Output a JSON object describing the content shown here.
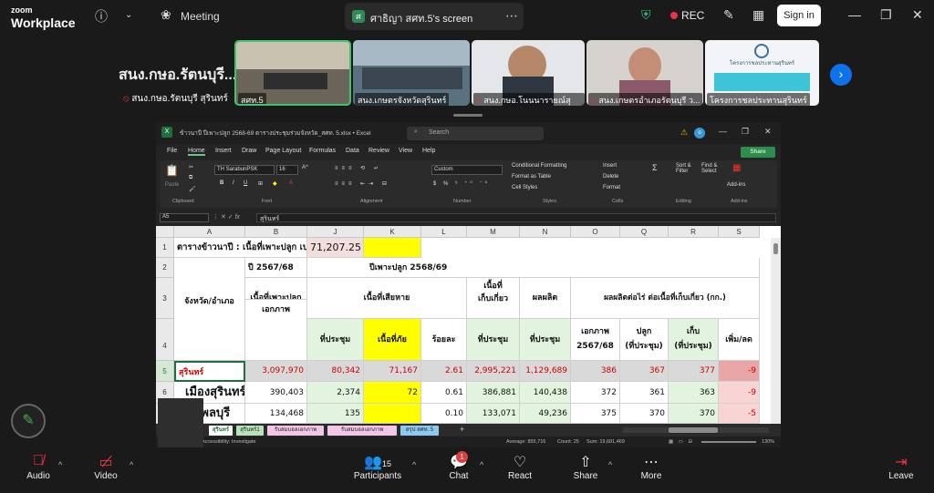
{
  "topbar": {
    "logo_line1": "zoom",
    "logo_line2": "Workplace",
    "meeting_label": "Meeting",
    "screen_label": "ศาธิญา สศท.5's screen",
    "avatar_letter": "ศ",
    "rec_label": "REC",
    "signin_label": "Sign in"
  },
  "participants_strip": {
    "title": "สนง.กษอ.รัตนบุรี...",
    "self_name": "สนง.กษอ.รัตนบุรี สุรินทร์",
    "tiles": [
      {
        "name": "สศท.5"
      },
      {
        "name": "สนง.เกษตรจังหวัดสุรินทร์"
      },
      {
        "name": "สนง.กษอ.โนนนารายณ์สุริน..."
      },
      {
        "name": "สนง.เกษตรอำเภอรัตนบุรี ว..."
      },
      {
        "name": "โครงการชลประทานสุรินทร์"
      }
    ],
    "tile5_banner": "โครงการชลประทานสุรินทร์"
  },
  "excel": {
    "filename": "ข้าวนาปี ปีเพาะปลูก 2568-69 ตารางประชุมร่วมจังหวัด_สศท. 5.xlsx  •  Excel",
    "search_placeholder": "Search",
    "share_label": "Share",
    "menu": [
      "File",
      "Home",
      "Insert",
      "Draw",
      "Page Layout",
      "Formulas",
      "Data",
      "Review",
      "View",
      "Help"
    ],
    "ribbon": {
      "groups": [
        "Clipboard",
        "Font",
        "Alignment",
        "Number",
        "Styles",
        "Cells",
        "Editing",
        "Add-ins"
      ],
      "paste": "Paste",
      "font_name": "TH SarabunPSK",
      "font_size": "16",
      "number_format": "Custom",
      "conditional": "Conditional Formatting",
      "format_table": "Format as Table",
      "cell_styles": "Cell Styles",
      "insert": "Insert",
      "delete": "Delete",
      "format": "Format",
      "sort": "Sort & Filter",
      "find": "Find & Select",
      "addins": "Add-ins"
    },
    "namebox": "A5",
    "formula": "สุรินทร์",
    "columns": [
      "A",
      "B",
      "J",
      "K",
      "L",
      "M",
      "N",
      "O",
      "Q",
      "R",
      "S"
    ],
    "rows": [
      "1",
      "2",
      "3",
      "4",
      "5",
      "6",
      "7"
    ],
    "cells": {
      "r1_label": "ตารางข้าวนาปี :  เนื้อที่เพาะปลูก เป",
      "r1_value": "71,207.25",
      "r2_b": "ปี 2567/68",
      "r2_k": "ปีเพาะปลูก 2568/69",
      "h_a": "จังหวัด/อำเภอ",
      "h_b1": "เนื้อที่เพาะปลูก",
      "h_b2": "เอกภาพ",
      "h_damage": "เนื้อที่เสียหาย",
      "h_m": "เนื้อที่\nเก็บเกี่ยว",
      "h_n": "ผลผลิต",
      "h_yield": "ผลผลิตต่อไร่ ต่อเนื้อที่เก็บเกี่ยว (กก.)",
      "h4_j": "ที่ประชุม",
      "h4_k": "เนื้อที่ภัย",
      "h4_l": "ร้อยละ",
      "h4_m": "ที่ประชุม",
      "h4_n": "ที่ประชุม",
      "h4_o": "เอกภาพ\n2567/68",
      "h4_q": "ปลูก\n(ที่ประชุม)",
      "h4_r": "เก็บ\n(ที่ประชุม)",
      "h4_s": "เพิ่ม/ลด"
    },
    "data_rows": [
      {
        "a": "สุรินทร์",
        "b": "3,097,970",
        "j": "80,342",
        "k": "71,167",
        "l": "2.61",
        "m": "2,995,221",
        "n": "1,129,689",
        "o": "386",
        "q": "367",
        "r": "377",
        "s": "-9"
      },
      {
        "a": "เมืองสุรินทร์",
        "b": "390,403",
        "j": "2,374",
        "k": "72",
        "l": "0.61",
        "m": "386,881",
        "n": "140,438",
        "o": "372",
        "q": "361",
        "r": "363",
        "s": "-9"
      },
      {
        "a": "ชุมพลบุรี",
        "b": "134,468",
        "j": "135",
        "k": "",
        "l": "0.10",
        "m": "133,071",
        "n": "49,236",
        "o": "375",
        "q": "370",
        "r": "370",
        "s": "-5"
      }
    ],
    "sheet_tabs": [
      "สุรินทร์",
      "สุรินทร์1",
      "รับสมบอลเอกภาพอำเภอ",
      "รับสมบอลเอกภาพอำเภอ(สูตร)",
      "สรุป สศท. 5"
    ],
    "status": {
      "accessibility": "Accessibility: Investigate",
      "average": "Average: 855,716",
      "count": "Count: 25",
      "sum": "Sum: 19,681,469",
      "zoom": "130%"
    }
  },
  "toolbar": {
    "audio": "Audio",
    "video": "Video",
    "participants": "Participants",
    "participants_count": "15",
    "chat": "Chat",
    "chat_badge": "1",
    "react": "React",
    "share": "Share",
    "more": "More",
    "leave": "Leave"
  }
}
